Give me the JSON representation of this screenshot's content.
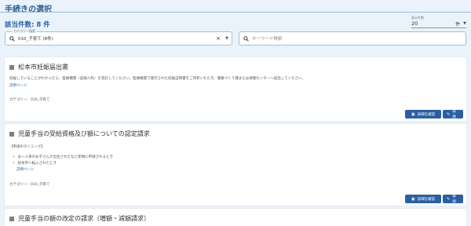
{
  "header": {
    "title": "手続きの選択"
  },
  "result": {
    "count_label": "該当件数: 8 件"
  },
  "per_page": {
    "label": "表示件数",
    "value": "20",
    "unit": "件"
  },
  "category_filter": {
    "floating_label": "カテゴリー検索",
    "value": "010_子育て (8件)"
  },
  "keyword_search": {
    "placeholder": "キーワード検索"
  },
  "cards": [
    {
      "title": "松本市妊娠届出書",
      "description": "妊娠していることがわかったら、医療機関（産婦人科）を受診してください。医療機関で発行された妊娠証明書をご持参いただき、健康づくり課または保健センターへ提出してください。",
      "link": "説明ページ",
      "category": "カテゴリー：010_子育て",
      "detail_button": "詳細を確認",
      "apply_button": "申請"
    },
    {
      "title": "児童手当の受給資格及び額についての認定請求",
      "timing": "【申請のタイミング】",
      "bullets": [
        "お一人目のお子さんが出生されたなど新規に申請されるとき",
        "松本市へ転入されたとき"
      ],
      "link": "説明ページ",
      "category": "カテゴリー：010_子育て",
      "detail_button": "詳細を確認",
      "apply_button": "申請"
    },
    {
      "title": "児童手当の額の改定の請求（増額・減額請求）"
    }
  ]
}
